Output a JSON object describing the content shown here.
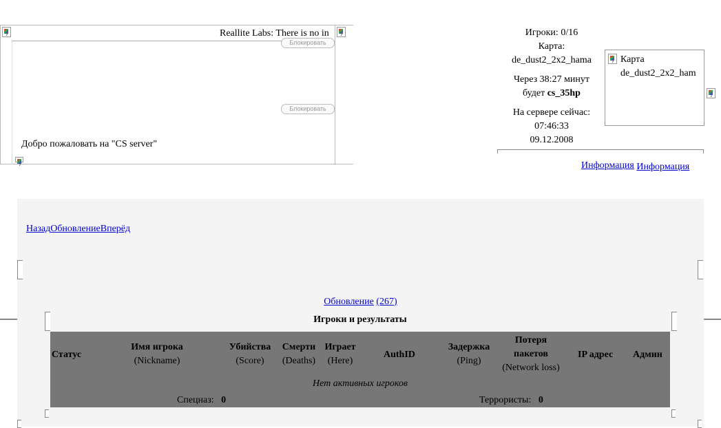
{
  "news": {
    "ticker": "Reallite Labs: There is no in",
    "block_label": "Блокировать",
    "welcome": "Добро пожаловать на \"CS server\""
  },
  "server": {
    "players": "Игроки: 0/16",
    "map_label": "Карта:",
    "map_name": "de_dust2_2x2_hama",
    "next_map_line": "Через 38:27 минут",
    "next_map_prefix": "будет",
    "next_map_name": "cs_35hp",
    "now_label": "На сервере сейчас:",
    "time": "07:46:33",
    "date": "09.12.2008"
  },
  "map_box": {
    "label": "Карта",
    "name": "de_dust2_2x2_ham"
  },
  "info_links": [
    "Информация",
    "Информация"
  ],
  "nav": {
    "back": "Назад",
    "refresh": "Обновление",
    "forward": "Вперёд"
  },
  "refresh_link": {
    "label": "Обновление",
    "count": "(267)"
  },
  "players_table": {
    "title": "Игроки и результаты",
    "columns": {
      "status": "Статус",
      "nick": "Имя игрока",
      "nick_sub": "(Nickname)",
      "kills": "Убийства",
      "kills_sub": "(Score)",
      "deaths": "Смерти",
      "deaths_sub": "(Deaths)",
      "here": "Играет",
      "here_sub": "(Here)",
      "authid": "AuthID",
      "ping": "Задержка",
      "ping_sub": "(Ping)",
      "loss1": "Потеря",
      "loss2": "пакетов",
      "loss_sub": "(Network loss)",
      "ip": "IP адрес",
      "admin": "Админ"
    },
    "empty": "Нет активных игроков",
    "ct_label": "Спецназ:",
    "ct_score": "0",
    "t_label": "Террористы:",
    "t_score": "0"
  }
}
